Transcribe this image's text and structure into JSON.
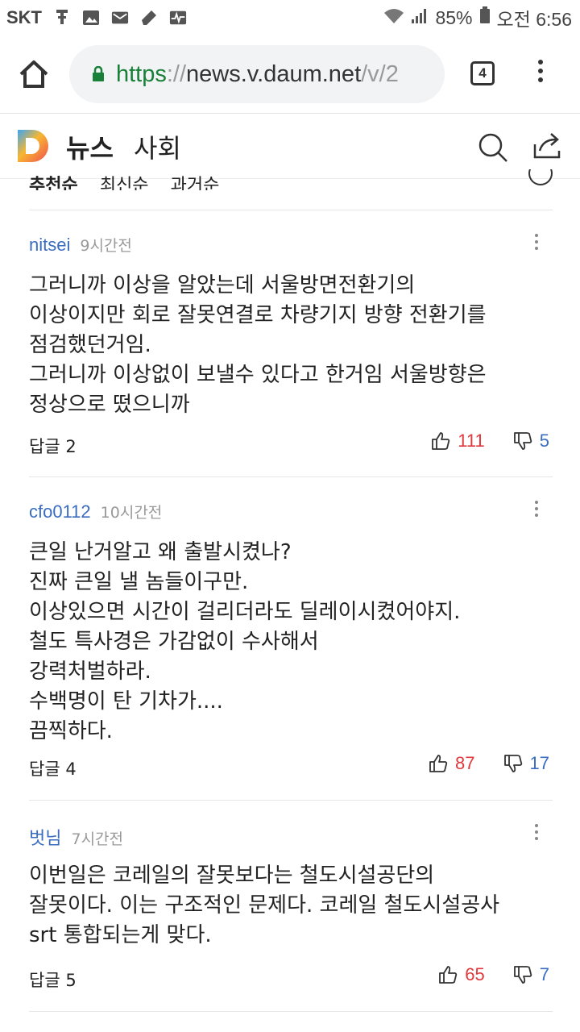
{
  "status_bar": {
    "carrier": "SKT",
    "battery": "85%",
    "time": "오전 6:56",
    "icons": [
      "usb-icon",
      "image-icon",
      "mail-icon",
      "pen-icon",
      "activity-icon",
      "wifi-icon",
      "signal-icon",
      "battery-icon"
    ]
  },
  "browser": {
    "url_scheme": "https",
    "url_sep": "://",
    "url_host": "news.v.daum.net",
    "url_path": "/v/2",
    "tab_count": "4"
  },
  "header": {
    "section": "뉴스",
    "subsection": "사회"
  },
  "sort": {
    "options": [
      "추천순",
      "최신순",
      "과거순"
    ]
  },
  "comments": [
    {
      "user": "nitsei",
      "time": "9시간전",
      "body": "그러니까 이상을 알았는데 서울방면전환기의\n이상이지만 회로 잘못연결로 차량기지 방향 전환기를\n점검했던거임.\n그러니까 이상없이 보낼수 있다고 한거임 서울방향은\n정상으로 떴으니까",
      "replies": "답글 2",
      "likes": "111",
      "dislikes": "5"
    },
    {
      "user": "cfo0112",
      "time": "10시간전",
      "body": "큰일 난거알고 왜 출발시켰나?\n진짜 큰일 낼 놈들이구만.\n이상있으면  시간이 걸리더라도  딜레이시켰어야지.\n철도 특사경은  가감없이 수사해서\n강력처벌하라.\n수백명이 탄 기차가....\n끔찍하다.",
      "replies": "답글 4",
      "likes": "87",
      "dislikes": "17"
    },
    {
      "user": "벗님",
      "time": "7시간전",
      "body": "이번일은  코레일의 잘못보다는 철도시설공단의\n잘못이다. 이는 구조적인 문제다. 코레일 철도시설공사\nsrt  통합되는게 맞다.",
      "replies": "답글 5",
      "likes": "65",
      "dislikes": "7"
    }
  ]
}
